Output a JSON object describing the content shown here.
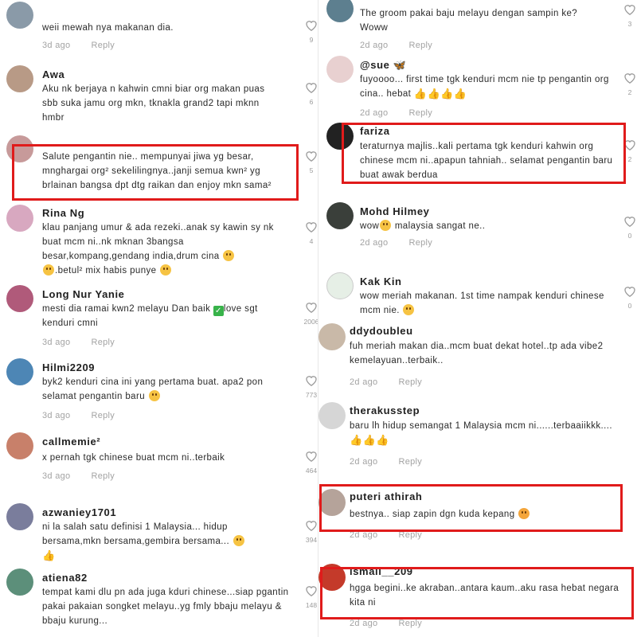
{
  "left": [
    {
      "name": "",
      "text": "weii mewah nya makanan dia.",
      "time": "3d ago",
      "reply": "Reply",
      "likes": "9"
    },
    {
      "name": "Awa",
      "text": "Aku nk berjaya n kahwin cmni biar org makan puas sbb suka jamu org mkn, tknakla grand2 tapi mknn hmbr",
      "time": "3d ago",
      "reply": "Reply",
      "likes": "6"
    },
    {
      "name": "",
      "text": "Salute pengantin nie.. mempunyai jiwa yg besar, mnghargai org² sekelilingnya..janji semua kwn² yg brlainan bangsa dpt dtg raikan dan enjoy mkn sama²",
      "time": "3d ago",
      "reply": "Reply",
      "likes": "5"
    },
    {
      "name": "Rina Ng",
      "text": "klau panjang umur & ada rezeki..anak sy kawin sy nk buat mcm ni..nk mknan 3bangsa besar,kompang,gendang india,drum cina",
      "text2": ".betul² mix habis punye",
      "time": "",
      "reply": "",
      "likes": "4"
    },
    {
      "name": "Long Nur Yanie",
      "text": "mesti dia ramai kwn2 melayu Dan baik",
      "text_end": "love sgt kenduri cmni",
      "time": "3d ago",
      "reply": "Reply",
      "likes": "2006"
    },
    {
      "name": "Hilmi2209",
      "text": "byk2 kenduri cina ini yang pertama buat. apa2 pon selamat pengantin baru",
      "time": "3d ago",
      "reply": "Reply",
      "likes": "773"
    },
    {
      "name": "callmemie²",
      "text": "x pernah tgk chinese buat mcm ni..terbaik",
      "time": "3d ago",
      "reply": "Reply",
      "likes": "464"
    },
    {
      "name": "azwaniey1701",
      "text": "ni la salah satu definisi 1 Malaysia... hidup bersama,mkn bersama,gembira bersama...",
      "time": "",
      "reply": "",
      "likes": "394"
    },
    {
      "name": "atiena82",
      "text": "tempat kami dlu pn ada juga kduri chinese...siap pgantin pakai pakaian songket melayu..yg fmly bbaju melayu & bbaju kurung...",
      "time": "",
      "reply": "",
      "likes": "148"
    }
  ],
  "right": [
    {
      "name": "",
      "text": "The groom pakai baju melayu dengan sampin ke? Woww",
      "time": "2d ago",
      "reply": "Reply",
      "likes": "3"
    },
    {
      "name": "@sue",
      "text": "fuyoooo... first time tgk kenduri mcm nie tp pengantin org cina.. hebat",
      "time": "2d ago",
      "reply": "Reply",
      "likes": "2"
    },
    {
      "name": "fariza",
      "text": "teraturnya majlis..kali pertama tgk kenduri kahwin org chinese mcm ni..apapun tahniah.. selamat pengantin baru buat awak berdua",
      "time": "",
      "reply": "",
      "likes": "2"
    },
    {
      "name": "Mohd Hilmey",
      "text": "wow",
      "text_end": "malaysia sangat ne..",
      "time": "2d ago",
      "reply": "Reply",
      "likes": "0"
    },
    {
      "name": "Kak Kin",
      "text": "wow meriah makanan. 1st time nampak kenduri chinese mcm nie.",
      "time": "",
      "reply": "",
      "likes": "0"
    },
    {
      "name": "ddydoubleu",
      "text": "fuh meriah makan dia..mcm buat dekat hotel..tp ada vibe2 kemelayuan..terbaik..",
      "time": "2d ago",
      "reply": "Reply",
      "likes": ""
    },
    {
      "name": "therakusstep",
      "text": "baru lh hidup semangat 1 Malaysia mcm ni......terbaaiikkk....",
      "time": "2d ago",
      "reply": "Reply",
      "likes": ""
    },
    {
      "name": "puteri athirah",
      "text": "bestnya.. siap zapin dgn kuda kepang",
      "time": "2d ago",
      "reply": "Reply",
      "likes": ""
    },
    {
      "name": "ismail__209",
      "text": "hgga begini..ke akraban..antara kaum..aku rasa hebat negara kita ni",
      "time": "2d ago",
      "reply": "Reply",
      "likes": ""
    }
  ],
  "colors": {
    "highlight": "#e01b1b",
    "meta": "#a3a3a3",
    "name": "#1f1f1f"
  }
}
